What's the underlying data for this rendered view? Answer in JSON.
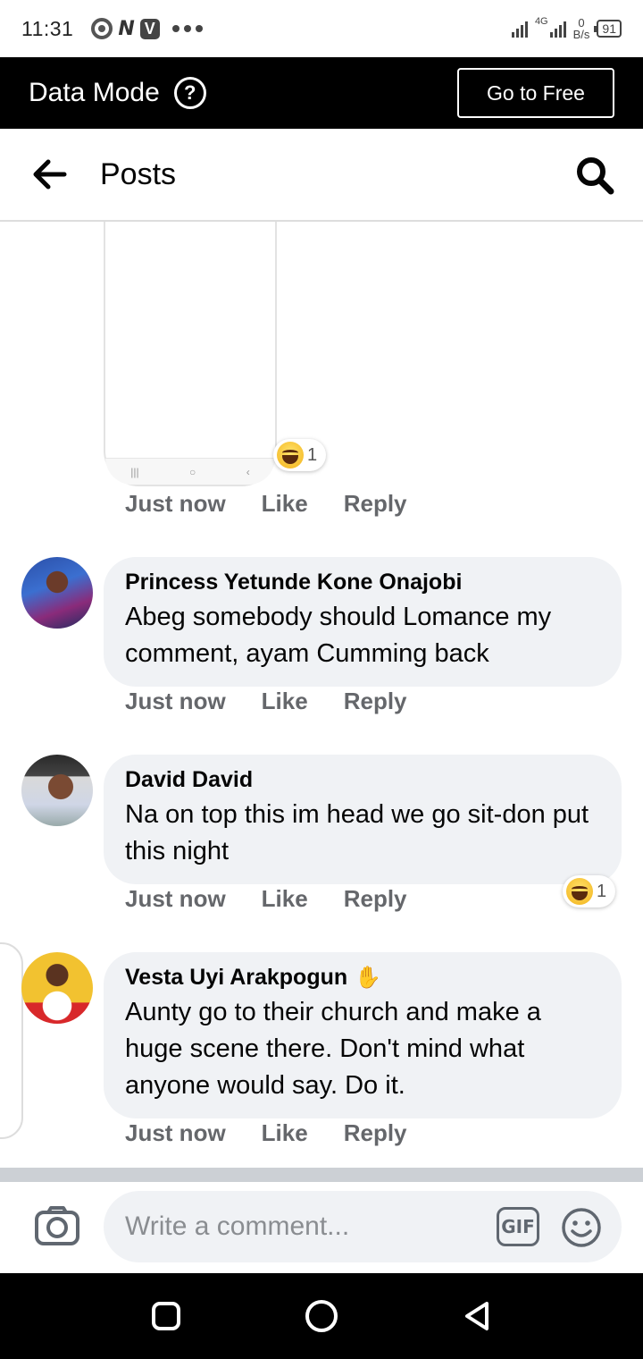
{
  "status_bar": {
    "time": "11:31",
    "network_label": "4G",
    "speed_value": "0",
    "speed_unit": "B/s",
    "battery": "91"
  },
  "data_mode": {
    "title": "Data Mode",
    "help_label": "?",
    "go_free_label": "Go to Free"
  },
  "header": {
    "title": "Posts"
  },
  "first_comment": {
    "reaction_count": "1",
    "time": "Just now",
    "like_label": "Like",
    "reply_label": "Reply"
  },
  "comments": [
    {
      "name": "Princess Yetunde Kone Onajobi",
      "text": "Abeg somebody should Lomance my comment, ayam Cumming back",
      "time": "Just now",
      "like_label": "Like",
      "reply_label": "Reply"
    },
    {
      "name": "David David",
      "text": "Na on top this im head we go sit-don put this night",
      "time": "Just now",
      "like_label": "Like",
      "reply_label": "Reply",
      "reaction_count": "1"
    },
    {
      "name": "Vesta Uyi Arakpogun",
      "text": "Aunty go to their church and make a huge scene there. Don't mind what anyone would say. Do it.",
      "time": "Just now",
      "like_label": "Like",
      "reply_label": "Reply"
    }
  ],
  "composer": {
    "placeholder": "Write a comment...",
    "gif_label": "GIF"
  },
  "icons": {
    "reaction": "laughing-emoji-icon",
    "camera": "camera-icon",
    "smiley": "smiley-icon",
    "back": "back-arrow-icon",
    "search": "search-icon"
  },
  "colors": {
    "bubble": "#f0f2f5",
    "meta_text": "#65676b",
    "data_mode_bg": "#000000"
  }
}
